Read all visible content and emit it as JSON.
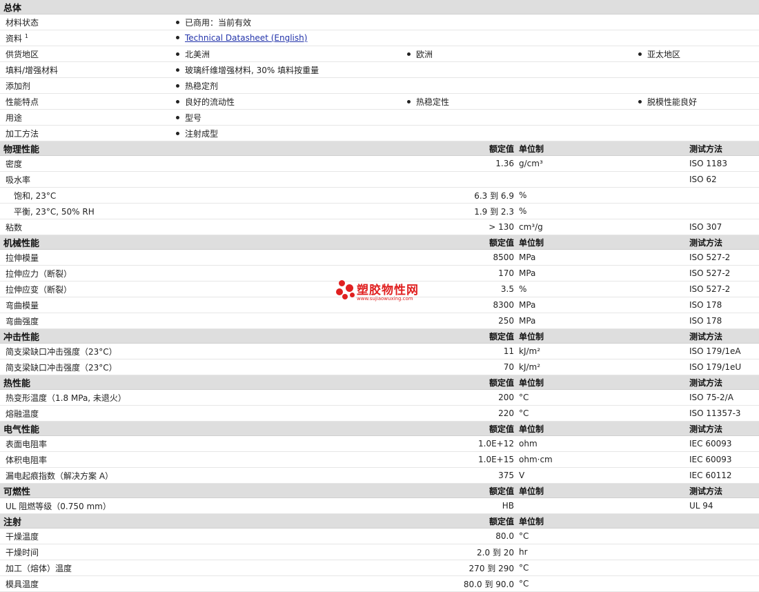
{
  "general": {
    "title": "总体",
    "rows": [
      {
        "label": "材料状态",
        "items": [
          "已商用：当前有效"
        ]
      },
      {
        "label": "资料",
        "sup": "1",
        "link": "Technical Datasheet (English)"
      },
      {
        "label": "供货地区",
        "items": [
          "北美洲",
          "欧洲",
          "亚太地区"
        ]
      },
      {
        "label": "填料/增强材料",
        "items": [
          "玻璃纤维增强材料, 30% 填料按重量"
        ]
      },
      {
        "label": "添加剂",
        "items": [
          "热稳定剂"
        ]
      },
      {
        "label": "性能特点",
        "items": [
          "良好的流动性",
          "热稳定性",
          "脱模性能良好"
        ]
      },
      {
        "label": "用途",
        "items": [
          "型号"
        ]
      },
      {
        "label": "加工方法",
        "items": [
          "注射成型"
        ]
      }
    ]
  },
  "headers": {
    "nominal": "额定值",
    "unit": "单位制",
    "method": "测试方法"
  },
  "sections": [
    {
      "title": "物理性能",
      "show_method": true,
      "rows": [
        {
          "label": "密度",
          "value": "1.36",
          "unit": "g/cm³",
          "method": "ISO 1183"
        },
        {
          "label": "吸水率",
          "value": "",
          "unit": "",
          "method": "ISO 62"
        },
        {
          "label": "饱和, 23°C",
          "sub": true,
          "value": "6.3 到  6.9",
          "unit": "%",
          "method": ""
        },
        {
          "label": "平衡, 23°C, 50% RH",
          "sub": true,
          "value": "1.9 到  2.3",
          "unit": "%",
          "method": ""
        },
        {
          "label": "粘数",
          "value": "> 130",
          "unit": "cm³/g",
          "method": "ISO 307"
        }
      ]
    },
    {
      "title": "机械性能",
      "show_method": true,
      "rows": [
        {
          "label": "拉伸模量",
          "value": "8500",
          "unit": "MPa",
          "method": "ISO 527-2"
        },
        {
          "label": "拉伸应力（断裂）",
          "value": "170",
          "unit": "MPa",
          "method": "ISO 527-2"
        },
        {
          "label": "拉伸应变（断裂）",
          "value": "3.5",
          "unit": "%",
          "method": "ISO 527-2"
        },
        {
          "label": "弯曲模量",
          "value": "8300",
          "unit": "MPa",
          "method": "ISO 178"
        },
        {
          "label": "弯曲强度",
          "value": "250",
          "unit": "MPa",
          "method": "ISO 178"
        }
      ]
    },
    {
      "title": "冲击性能",
      "show_method": true,
      "rows": [
        {
          "label": "简支梁缺口冲击强度（23°C）",
          "value": "11",
          "unit": "kJ/m²",
          "method": "ISO 179/1eA"
        },
        {
          "label": "简支梁缺口冲击强度（23°C）",
          "value": "70",
          "unit": "kJ/m²",
          "method": "ISO 179/1eU"
        }
      ]
    },
    {
      "title": "热性能",
      "show_method": true,
      "rows": [
        {
          "label": "热变形温度（1.8 MPa, 未退火）",
          "value": "200",
          "unit": "°C",
          "method": "ISO 75-2/A"
        },
        {
          "label": "熔融温度",
          "value": "220",
          "unit": "°C",
          "method": "ISO 11357-3"
        }
      ]
    },
    {
      "title": "电气性能",
      "show_method": true,
      "rows": [
        {
          "label": "表面电阻率",
          "value": "1.0E+12",
          "unit": "ohm",
          "method": "IEC 60093"
        },
        {
          "label": "体积电阻率",
          "value": "1.0E+15",
          "unit": "ohm·cm",
          "method": "IEC 60093"
        },
        {
          "label": "漏电起痕指数（解决方案 A）",
          "value": "375",
          "unit": "V",
          "method": "IEC 60112"
        }
      ]
    },
    {
      "title": "可燃性",
      "show_method": true,
      "rows": [
        {
          "label": "UL 阻燃等级（0.750 mm）",
          "value": "HB",
          "unit": "",
          "method": "UL 94"
        }
      ]
    },
    {
      "title": "注射",
      "show_method": false,
      "rows": [
        {
          "label": "干燥温度",
          "value": "80.0",
          "unit": "°C",
          "method": ""
        },
        {
          "label": "干燥时间",
          "value": "2.0 到  20",
          "unit": "hr",
          "method": ""
        },
        {
          "label": "加工（熔体）温度",
          "value": "270 到  290",
          "unit": "°C",
          "method": ""
        },
        {
          "label": "模具温度",
          "value": "80.0 到  90.0",
          "unit": "°C",
          "method": ""
        }
      ]
    }
  ],
  "watermark": {
    "text": "塑胶物性网",
    "url": "www.sujiaowuxing.com"
  }
}
